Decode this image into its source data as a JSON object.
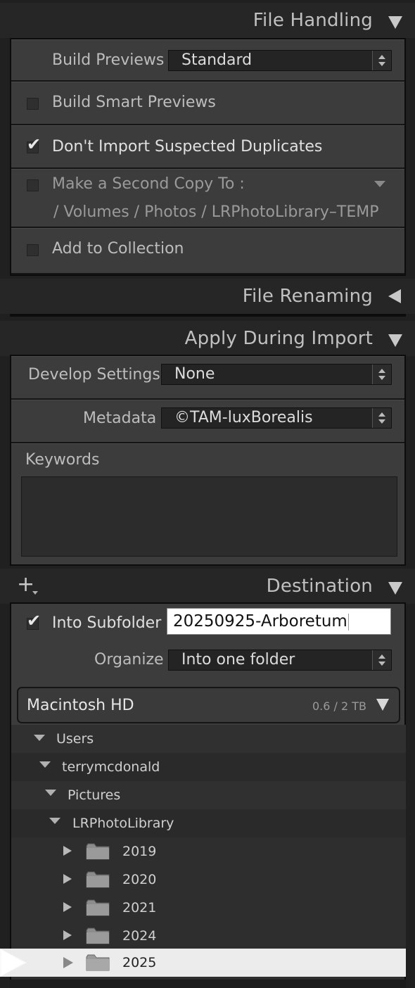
{
  "file_handling": {
    "title": "File Handling",
    "build_previews_label": "Build Previews",
    "build_previews_value": "Standard",
    "build_smart_previews_label": "Build Smart Previews",
    "build_smart_previews_checked": false,
    "dont_import_duplicates_label": "Don't Import Suspected Duplicates",
    "dont_import_duplicates_checked": true,
    "second_copy_label": "Make a Second Copy To :",
    "second_copy_checked": false,
    "second_copy_path": "/ Volumes / Photos / LRPhotoLibrary–TEMP",
    "add_to_collection_label": "Add to Collection",
    "add_to_collection_checked": false
  },
  "file_renaming": {
    "title": "File Renaming"
  },
  "apply_during_import": {
    "title": "Apply During Import",
    "develop_settings_label": "Develop Settings",
    "develop_settings_value": "None",
    "metadata_label": "Metadata",
    "metadata_value": "©TAM-luxBorealis",
    "keywords_label": "Keywords",
    "keywords_value": ""
  },
  "destination": {
    "title": "Destination",
    "add_icon": "+",
    "into_subfolder_label": "Into Subfolder",
    "into_subfolder_checked": true,
    "subfolder_name": "20250925-Arboretum",
    "organize_label": "Organize",
    "organize_value": "Into one folder",
    "volume_name": "Macintosh HD",
    "volume_usage": "0.6 / 2 TB",
    "tree": {
      "users": "Users",
      "user": "terrymcdonald",
      "pictures": "Pictures",
      "library": "LRPhotoLibrary",
      "folders": [
        "2019",
        "2020",
        "2021",
        "2024",
        "2025"
      ]
    }
  },
  "colors": {
    "background": "#202020",
    "panel": "#3c3c3c",
    "selected_row": "#efefef"
  }
}
